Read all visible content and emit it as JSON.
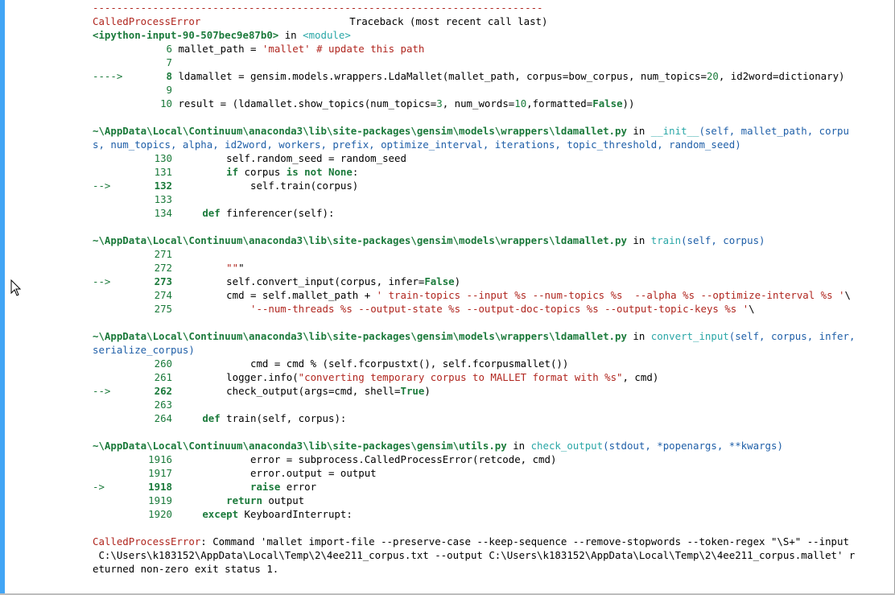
{
  "traceback": {
    "separator": "---------------------------------------------------------------------------",
    "error_name": "CalledProcessError",
    "header": "Traceback (most recent call last)",
    "frames": [
      {
        "file": "<ipython-input-90-507bec9e87b0>",
        "in": " in ",
        "func": "<module>",
        "args": "",
        "args_cont": "",
        "lines": [
          {
            "arrow": "",
            "num": "6",
            "code": "mallet_path = 'mallet' # update this path"
          },
          {
            "arrow": "",
            "num": "7",
            "code": ""
          },
          {
            "arrow": "---->",
            "num": "8",
            "code": "ldamallet = gensim.models.wrappers.LdaMallet(mallet_path, corpus=bow_corpus, num_topics=20, id2word=dictionary)"
          },
          {
            "arrow": "",
            "num": "9",
            "code": ""
          },
          {
            "arrow": "",
            "num": "10",
            "code": "result = (ldamallet.show_topics(num_topics=3, num_words=10,formatted=False))"
          }
        ]
      },
      {
        "file": "~\\AppData\\Local\\Continuum\\anaconda3\\lib\\site-packages\\gensim\\models\\wrappers\\ldamallet.py",
        "in": " in ",
        "func": "__init__",
        "args": "(self, mallet_path, corpu",
        "args_cont": "s, num_topics, alpha, id2word, workers, prefix, optimize_interval, iterations, topic_threshold, random_seed)",
        "lines": [
          {
            "arrow": "",
            "num": "130",
            "code": "        self.random_seed = random_seed"
          },
          {
            "arrow": "",
            "num": "131",
            "code": "        if corpus is not None:"
          },
          {
            "arrow": "-->",
            "num": "132",
            "code": "            self.train(corpus)"
          },
          {
            "arrow": "",
            "num": "133",
            "code": ""
          },
          {
            "arrow": "",
            "num": "134",
            "code": "    def finferencer(self):"
          }
        ]
      },
      {
        "file": "~\\AppData\\Local\\Continuum\\anaconda3\\lib\\site-packages\\gensim\\models\\wrappers\\ldamallet.py",
        "in": " in ",
        "func": "train",
        "args": "(self, corpus)",
        "args_cont": "",
        "lines": [
          {
            "arrow": "",
            "num": "271",
            "code": ""
          },
          {
            "arrow": "",
            "num": "272",
            "code": "        \"\"\""
          },
          {
            "arrow": "-->",
            "num": "273",
            "code": "        self.convert_input(corpus, infer=False)"
          },
          {
            "arrow": "",
            "num": "274",
            "code": "        cmd = self.mallet_path + ' train-topics --input %s --num-topics %s  --alpha %s --optimize-interval %s '\\"
          },
          {
            "arrow": "",
            "num": "275",
            "code": "            '--num-threads %s --output-state %s --output-doc-topics %s --output-topic-keys %s '\\"
          }
        ]
      },
      {
        "file": "~\\AppData\\Local\\Continuum\\anaconda3\\lib\\site-packages\\gensim\\models\\wrappers\\ldamallet.py",
        "in": " in ",
        "func": "convert_input",
        "args": "(self, corpus, infer,",
        "args_cont": "serialize_corpus)",
        "lines": [
          {
            "arrow": "",
            "num": "260",
            "code": "            cmd = cmd % (self.fcorpustxt(), self.fcorpusmallet())"
          },
          {
            "arrow": "",
            "num": "261",
            "code": "        logger.info(\"converting temporary corpus to MALLET format with %s\", cmd)"
          },
          {
            "arrow": "-->",
            "num": "262",
            "code": "        check_output(args=cmd, shell=True)"
          },
          {
            "arrow": "",
            "num": "263",
            "code": ""
          },
          {
            "arrow": "",
            "num": "264",
            "code": "    def train(self, corpus):"
          }
        ]
      },
      {
        "file": "~\\AppData\\Local\\Continuum\\anaconda3\\lib\\site-packages\\gensim\\utils.py",
        "in": " in ",
        "func": "check_output",
        "args": "(stdout, *popenargs, **kwargs)",
        "args_cont": "",
        "lines": [
          {
            "arrow": "",
            "num": "1916",
            "code": "            error = subprocess.CalledProcessError(retcode, cmd)"
          },
          {
            "arrow": "",
            "num": "1917",
            "code": "            error.output = output"
          },
          {
            "arrow": "->",
            "num": "1918",
            "code": "            raise error"
          },
          {
            "arrow": "",
            "num": "1919",
            "code": "        return output"
          },
          {
            "arrow": "",
            "num": "1920",
            "code": "    except KeyboardInterrupt:"
          }
        ]
      }
    ],
    "final_error": {
      "name": "CalledProcessError",
      "line1": ": Command 'mallet import-file --preserve-case --keep-sequence --remove-stopwords --token-regex \"\\S+\" --input",
      "line2": " C:\\Users\\k183152\\AppData\\Local\\Temp\\2\\4ee211_corpus.txt --output C:\\Users\\k183152\\AppData\\Local\\Temp\\2\\4ee211_corpus.mallet' r",
      "line3": "eturned non-zero exit status 1."
    }
  },
  "colors": {
    "cell_bar": "#42a5f5",
    "line_number": "#1b7a3b",
    "error_name": "#b0261f",
    "file_path": "#1f5fa8",
    "function_name": "#2aa7a7"
  },
  "icons": {
    "pointer": "mouse-pointer-icon"
  }
}
